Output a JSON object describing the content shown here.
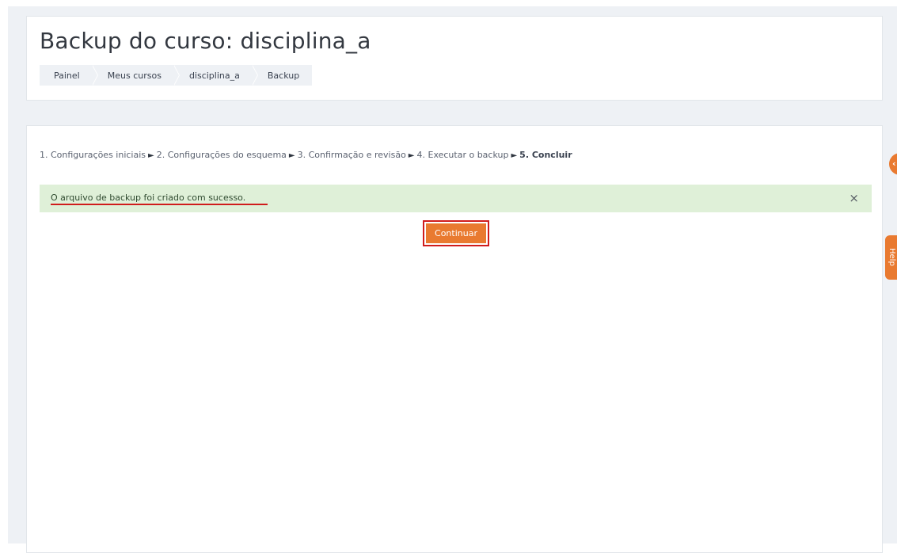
{
  "header": {
    "title": "Backup do curso: disciplina_a",
    "breadcrumb": [
      "Painel",
      "Meus cursos",
      "disciplina_a",
      "Backup"
    ]
  },
  "progress": {
    "steps": [
      "1. Configurações iniciais",
      "2. Configurações do esquema",
      "3. Confirmação e revisão",
      "4. Executar o backup",
      "5. Concluir"
    ],
    "separator": "►"
  },
  "alert": {
    "message": "O arquivo de backup foi criado com sucesso.",
    "close_label": "×"
  },
  "actions": {
    "continue_label": "Continuar"
  },
  "side": {
    "top_tab_icon": "‹",
    "help_label": "Help"
  },
  "colors": {
    "accent": "#e97a30",
    "success_bg": "#dff0d8",
    "highlight": "#d01c1c"
  }
}
